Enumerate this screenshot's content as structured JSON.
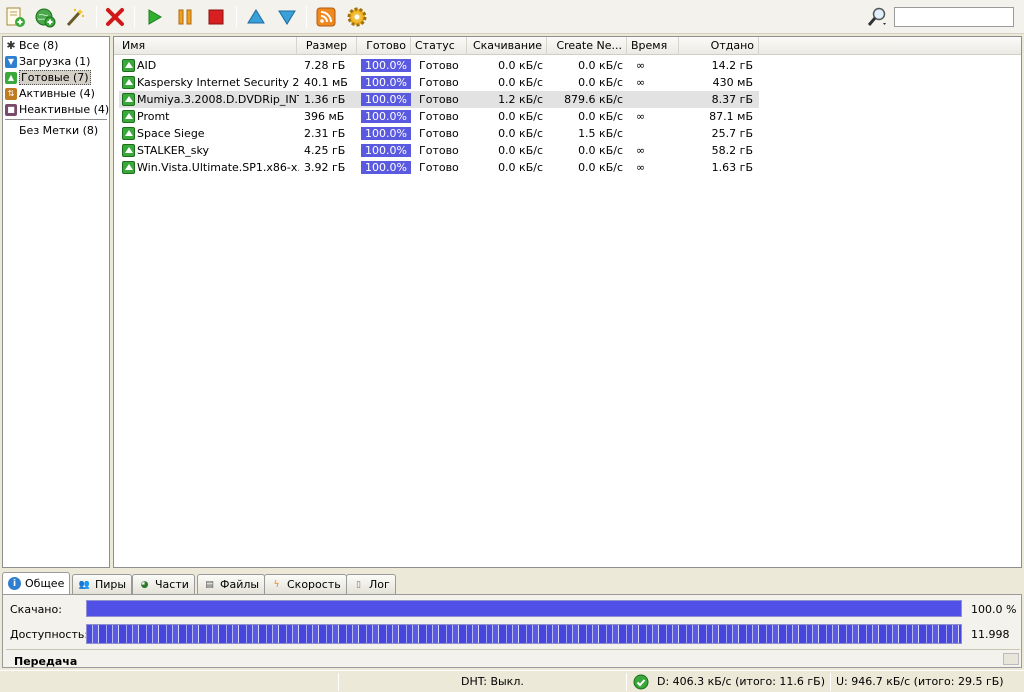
{
  "toolbar": {
    "buttons": [
      "add-torrent",
      "add-torrent-url",
      "create-torrent",
      "remove",
      "start",
      "pause",
      "stop",
      "move-up",
      "move-down",
      "rss",
      "preferences"
    ],
    "search_placeholder": ""
  },
  "sidebar": {
    "items": [
      {
        "label": "Все (8)",
        "icon": "all-icon",
        "color": "#333333"
      },
      {
        "label": "Загрузка (1)",
        "icon": "download-icon",
        "color": "#2f7fd0"
      },
      {
        "label": "Готовые (7)",
        "icon": "seeding-icon",
        "color": "#3aa83a"
      },
      {
        "label": "Активные (4)",
        "icon": "active-icon",
        "color": "#c07a20"
      },
      {
        "label": "Неактивные (4)",
        "icon": "inactive-icon",
        "color": "#7a4a6a"
      }
    ],
    "labels": [
      {
        "label": "Без Метки (8)"
      }
    ]
  },
  "list": {
    "columns": [
      "Имя",
      "Размер",
      "Готово",
      "Статус",
      "Скачивание",
      "Create Ne...",
      "Время",
      "Отдано"
    ],
    "rows": [
      {
        "name": "AID",
        "size": "7.28 гБ",
        "done": "100.0%",
        "status": "Готово",
        "down": "0.0 кБ/с",
        "up": "0.0 кБ/с",
        "eta": "∞",
        "uploaded": "14.2 гБ"
      },
      {
        "name": "Kaspersky Internet Security 2...",
        "size": "40.1 мБ",
        "done": "100.0%",
        "status": "Готово",
        "down": "0.0 кБ/с",
        "up": "0.0 кБ/с",
        "eta": "∞",
        "uploaded": "430 мБ"
      },
      {
        "name": "Mumiya.3.2008.D.DVDRip_INT...",
        "size": "1.36 гБ",
        "done": "100.0%",
        "status": "Готово",
        "down": "1.2 кБ/с",
        "up": "879.6 кБ/с",
        "eta": "",
        "uploaded": "8.37 гБ"
      },
      {
        "name": "Promt",
        "size": "396 мБ",
        "done": "100.0%",
        "status": "Готово",
        "down": "0.0 кБ/с",
        "up": "0.0 кБ/с",
        "eta": "∞",
        "uploaded": "87.1 мБ"
      },
      {
        "name": "Space Siege",
        "size": "2.31 гБ",
        "done": "100.0%",
        "status": "Готово",
        "down": "0.0 кБ/с",
        "up": "1.5 кБ/с",
        "eta": "",
        "uploaded": "25.7 гБ"
      },
      {
        "name": "STALKER_sky",
        "size": "4.25 гБ",
        "done": "100.0%",
        "status": "Готово",
        "down": "0.0 кБ/с",
        "up": "0.0 кБ/с",
        "eta": "∞",
        "uploaded": "58.2 гБ"
      },
      {
        "name": "Win.Vista.Ultimate.SP1.x86-x...",
        "size": "3.92 гБ",
        "done": "100.0%",
        "status": "Готово",
        "down": "0.0 кБ/с",
        "up": "0.0 кБ/с",
        "eta": "∞",
        "uploaded": "1.63 гБ"
      }
    ]
  },
  "tabs": [
    "Общее",
    "Пиры",
    "Части",
    "Файлы",
    "Скорость",
    "Лог"
  ],
  "detail": {
    "downloaded_label": "Скачано:",
    "downloaded_value": "100.0 %",
    "downloaded_fraction": 1.0,
    "availability_label": "Доступность:",
    "availability_value": "11.998",
    "section_title": "Передача"
  },
  "statusbar": {
    "dht": "DHT: Выкл.",
    "download": "D: 406.3 кБ/с (итого: 11.6 гБ)",
    "upload": "U: 946.7 кБ/с (итого: 29.5 гБ)"
  },
  "colors": {
    "progress": "#5050e6",
    "ok": "#3aa83a"
  }
}
